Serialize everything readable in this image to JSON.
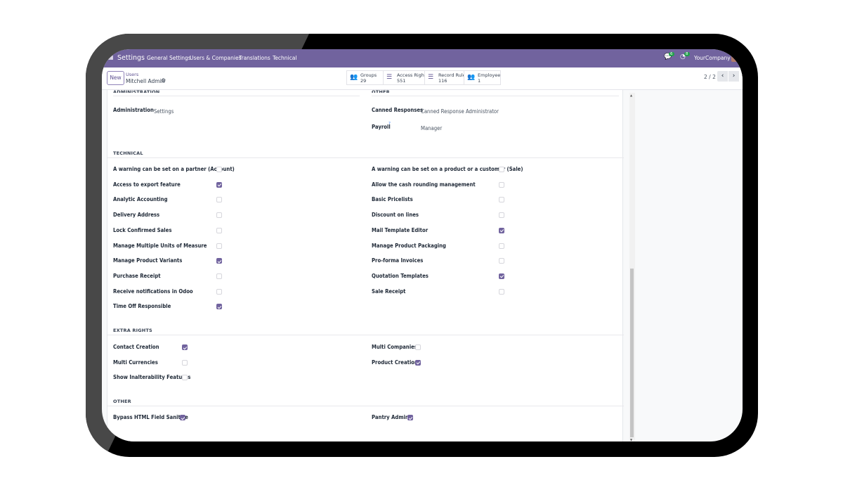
{
  "navbar": {
    "app": "Settings",
    "menus": [
      "General Settings",
      "Users & Companies",
      "Translations",
      "Technical"
    ],
    "messages_count": "6",
    "activities_count": "8",
    "company": "YourCompany",
    "color": "#71639e"
  },
  "control_panel": {
    "new_label": "New",
    "breadcrumb_parent": "Users",
    "record_name": "Mitchell Admin",
    "pager": "2 / 2",
    "stats": [
      {
        "label": "Groups",
        "value": "29",
        "icon": "users-icon"
      },
      {
        "label": "Access Rights",
        "value": "551",
        "icon": "list-icon"
      },
      {
        "label": "Record Rules",
        "value": "116",
        "icon": "list-icon"
      },
      {
        "label": "Employee",
        "value": "1",
        "icon": "users-icon"
      }
    ]
  },
  "sections": {
    "administration": {
      "title": "ADMINISTRATION",
      "fields": [
        {
          "label": "Administration",
          "value": "Settings"
        }
      ]
    },
    "other_top": {
      "title": "OTHER",
      "fields": [
        {
          "label": "Canned Responses",
          "value": "Canned Response Administrator"
        },
        {
          "label": "Payroll",
          "help": "?",
          "value": "Manager"
        }
      ]
    },
    "technical": {
      "title": "TECHNICAL",
      "left": [
        {
          "label": "A warning can be set on a partner (Account)",
          "checked": false
        },
        {
          "label": "Access to export feature",
          "checked": true
        },
        {
          "label": "Analytic Accounting",
          "checked": false
        },
        {
          "label": "Delivery Address",
          "checked": false
        },
        {
          "label": "Lock Confirmed Sales",
          "checked": false
        },
        {
          "label": "Manage Multiple Units of Measure",
          "checked": false
        },
        {
          "label": "Manage Product Variants",
          "checked": true
        },
        {
          "label": "Purchase Receipt",
          "checked": false
        },
        {
          "label": "Receive notifications in Odoo",
          "checked": false
        },
        {
          "label": "Time Off Responsible",
          "checked": true
        }
      ],
      "right": [
        {
          "label": "A warning can be set on a product or a customer (Sale)",
          "checked": false
        },
        {
          "label": "Allow the cash rounding management",
          "checked": false
        },
        {
          "label": "Basic Pricelists",
          "checked": false
        },
        {
          "label": "Discount on lines",
          "checked": false
        },
        {
          "label": "Mail Template Editor",
          "checked": true
        },
        {
          "label": "Manage Product Packaging",
          "checked": false
        },
        {
          "label": "Pro-forma Invoices",
          "checked": false
        },
        {
          "label": "Quotation Templates",
          "checked": true
        },
        {
          "label": "Sale Receipt",
          "checked": false
        }
      ]
    },
    "extra_rights": {
      "title": "EXTRA RIGHTS",
      "left": [
        {
          "label": "Contact Creation",
          "checked": true
        },
        {
          "label": "Multi Currencies",
          "checked": false
        },
        {
          "label": "Show Inalterability Features",
          "checked": false
        }
      ],
      "right": [
        {
          "label": "Multi Companies",
          "checked": false
        },
        {
          "label": "Product Creation",
          "checked": true
        }
      ]
    },
    "other": {
      "title": "OTHER",
      "left": [
        {
          "label": "Bypass HTML Field Sanitize",
          "checked": true
        }
      ],
      "right": [
        {
          "label": "Pantry Admin",
          "checked": true,
          "highlighted": true
        }
      ]
    }
  }
}
